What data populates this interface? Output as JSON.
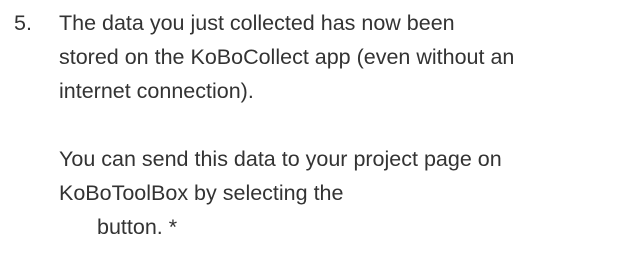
{
  "step": {
    "number": "5.",
    "paragraph_1": {
      "lines": [
        "The data you just collected has now been",
        "stored on the KoBoCollect app (even without an",
        "internet connection)."
      ]
    },
    "paragraph_2": {
      "lines": [
        "You can send this data to your project page on",
        "KoBoToolBox by selecting the",
        "button. *"
      ]
    }
  }
}
